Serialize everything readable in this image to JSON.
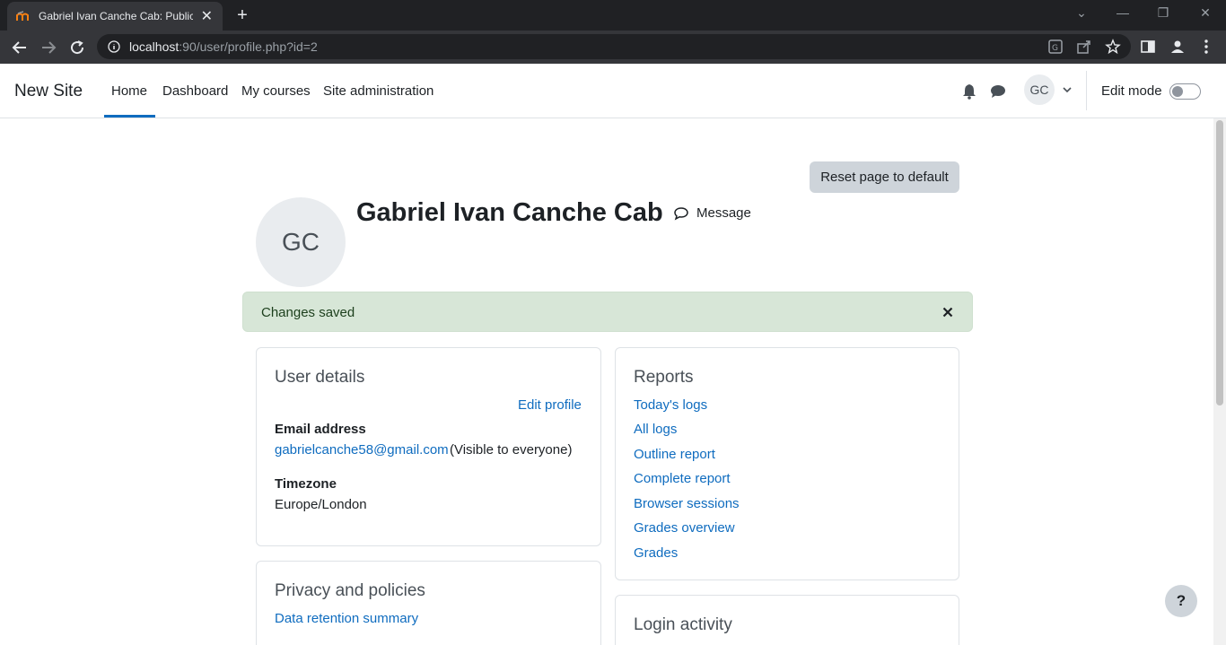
{
  "browser": {
    "tab_title": "Gabriel Ivan Canche Cab: Public p",
    "url_host": "localhost",
    "url_path": ":90/user/profile.php?id=2"
  },
  "navbar": {
    "brand": "New Site",
    "items": [
      {
        "label": "Home",
        "active": true
      },
      {
        "label": "Dashboard",
        "active": false
      },
      {
        "label": "My courses",
        "active": false
      },
      {
        "label": "Site administration",
        "active": false
      }
    ],
    "user_initials": "GC",
    "edit_mode_label": "Edit mode",
    "edit_mode_on": false
  },
  "page": {
    "reset_button": "Reset page to default",
    "avatar_initials": "GC",
    "full_name": "Gabriel Ivan Canche Cab",
    "message_label": "Message",
    "alert_text": "Changes saved"
  },
  "user_details": {
    "title": "User details",
    "edit_profile": "Edit profile",
    "email_label": "Email address",
    "email_value": "gabrielcanche58@gmail.com",
    "email_visibility": "(Visible to everyone)",
    "timezone_label": "Timezone",
    "timezone_value": "Europe/London"
  },
  "privacy": {
    "title": "Privacy and policies",
    "link": "Data retention summary"
  },
  "reports": {
    "title": "Reports",
    "links": [
      "Today's logs",
      "All logs",
      "Outline report",
      "Complete report",
      "Browser sessions",
      "Grades overview",
      "Grades"
    ]
  },
  "login_activity": {
    "title": "Login activity"
  },
  "help": {
    "label": "?"
  },
  "colors": {
    "link": "#0f6cbf",
    "alert_bg": "#d7e6d7",
    "active_nav": "#0f6cbf"
  }
}
